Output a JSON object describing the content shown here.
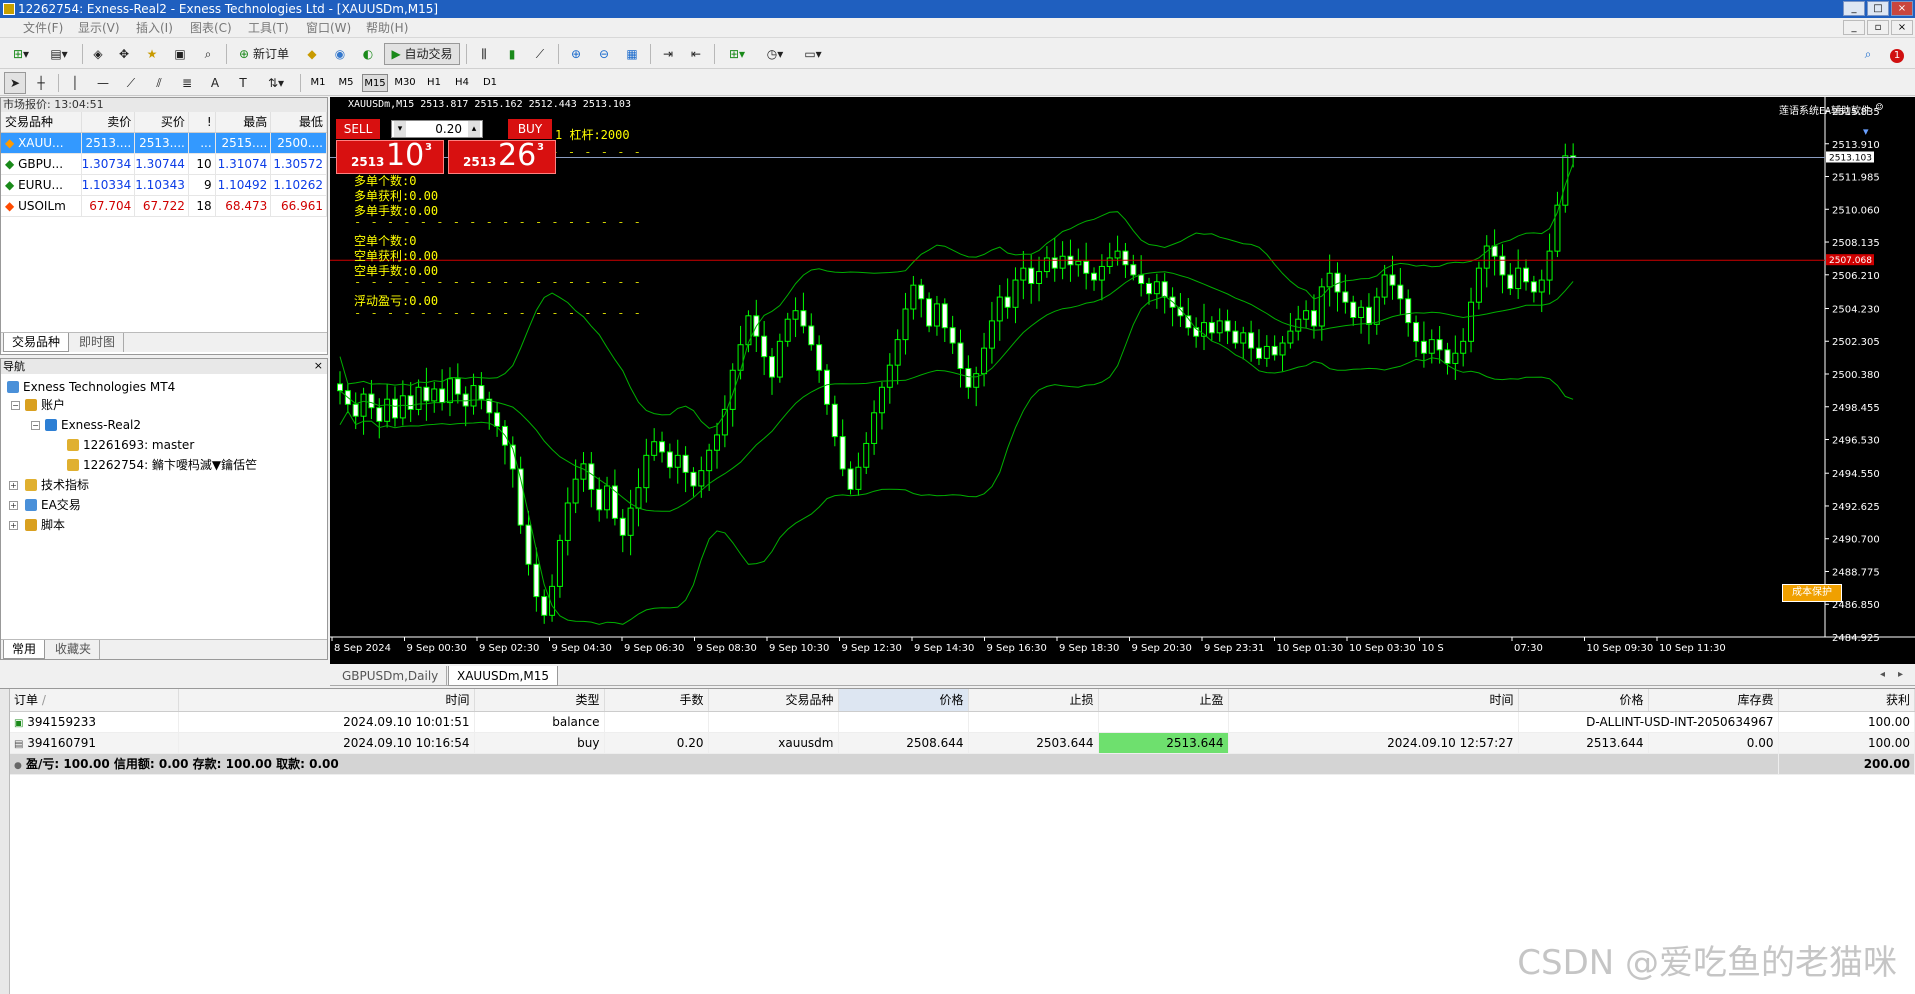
{
  "window": {
    "title": "12262754: Exness-Real2 - Exness Technologies Ltd - [XAUUSDm,M15]"
  },
  "menu": [
    "文件(F)",
    "显示(V)",
    "插入(I)",
    "图表(C)",
    "工具(T)",
    "窗口(W)",
    "帮助(H)"
  ],
  "toolbar": {
    "new_order": "新订单",
    "auto_trade": "自动交易",
    "notify_count": "1"
  },
  "timeframes": [
    "M1",
    "M5",
    "M15",
    "M30",
    "H1",
    "H4",
    "D1"
  ],
  "market_watch": {
    "title": "市场报价: 13:04:51",
    "columns": [
      "交易品种",
      "卖价",
      "买价",
      "!",
      "最高",
      "最低"
    ],
    "rows": [
      {
        "symbol": "XAUU...",
        "bid": "2513....",
        "ask": "2513....",
        "spread": "...",
        "high": "2515....",
        "low": "2500...."
      },
      {
        "symbol": "GBPU...",
        "bid": "1.30734",
        "ask": "1.30744",
        "spread": "10",
        "high": "1.31074",
        "low": "1.30572"
      },
      {
        "symbol": "EURU...",
        "bid": "1.10334",
        "ask": "1.10343",
        "spread": "9",
        "high": "1.10492",
        "low": "1.10262"
      },
      {
        "symbol": "USOILm",
        "bid": "67.704",
        "ask": "67.722",
        "spread": "18",
        "high": "68.473",
        "low": "66.961"
      }
    ],
    "tabs": [
      "交易品种",
      "即时图"
    ]
  },
  "navigator": {
    "title": "导航",
    "root": "Exness Technologies MT4",
    "accounts": "账户",
    "server": "Exness-Real2",
    "acc1": "12261693: master",
    "acc2": "12262754: 鏅卞噯杩滅▼鑰佸笀",
    "indicators": "技术指标",
    "ea": "EA交易",
    "scripts": "脚本",
    "tabs": [
      "常用",
      "收藏夹"
    ]
  },
  "chart": {
    "header": "XAUUSDm,M15  2513.817 2515.162 2512.443 2513.103",
    "ea_name": "莲语系统EA辅助软件",
    "leverage": "1 杠杆:2000",
    "long_count": "多单个数:0",
    "long_profit": "多单获利:0.00",
    "long_lots": "多单手数:0.00",
    "short_count": "空单个数:0",
    "short_profit": "空单获利:0.00",
    "short_lots": "空单手数:0.00",
    "floating": "浮动盈亏:0.00",
    "sell_label": "SELL",
    "buy_label": "BUY",
    "lots": "0.20",
    "sell_price_small": "2513",
    "sell_price_big": "10",
    "sell_price_sup": "3",
    "buy_price_small": "2513",
    "buy_price_big": "26",
    "buy_price_sup": "3",
    "protect_btn": "成本保护",
    "current_price": "2513.103",
    "line_price": "2507.068",
    "price_labels": [
      "2515.835",
      "2513.910",
      "2511.985",
      "2510.060",
      "2508.135",
      "2506.210",
      "2504.230",
      "2502.305",
      "2500.380",
      "2498.455",
      "2496.530",
      "2494.550",
      "2492.625",
      "2490.700",
      "2488.775",
      "2486.850",
      "2484.925"
    ],
    "time_labels": [
      "8 Sep 2024",
      "9 Sep 00:30",
      "9 Sep 02:30",
      "9 Sep 04:30",
      "9 Sep 06:30",
      "9 Sep 08:30",
      "9 Sep 10:30",
      "9 Sep 12:30",
      "9 Sep 14:30",
      "9 Sep 16:30",
      "9 Sep 18:30",
      "9 Sep 20:30",
      "9 Sep 23:31",
      "10 Sep 01:30",
      "10 Sep 03:30",
      "10 S",
      "07:30",
      "10 Sep 09:30",
      "10 Sep 11:30"
    ],
    "tabs": [
      "GBPUSDm,Daily",
      "XAUUSDm,M15"
    ]
  },
  "chart_data": {
    "type": "candlestick",
    "symbol": "XAUUSDm",
    "timeframe": "M15",
    "ylim": [
      2484.925,
      2515.835
    ],
    "closes": [
      2499.4,
      2498.6,
      2497.9,
      2499.2,
      2498.4,
      2497.6,
      2498.9,
      2497.8,
      2499.1,
      2498.3,
      2499.6,
      2498.8,
      2499.5,
      2498.7,
      2500.1,
      2499.2,
      2498.5,
      2499.7,
      2498.9,
      2498.1,
      2497.3,
      2496.2,
      2494.8,
      2491.5,
      2489.2,
      2487.3,
      2486.2,
      2487.9,
      2490.6,
      2492.8,
      2494.2,
      2495.1,
      2493.6,
      2492.4,
      2493.8,
      2491.9,
      2490.9,
      2492.5,
      2493.7,
      2495.6,
      2496.4,
      2495.8,
      2494.9,
      2495.6,
      2494.6,
      2493.8,
      2494.7,
      2495.9,
      2496.8,
      2498.3,
      2500.6,
      2502.1,
      2503.8,
      2502.6,
      2501.4,
      2500.2,
      2502.3,
      2503.6,
      2504.1,
      2503.2,
      2502.1,
      2500.6,
      2498.6,
      2496.7,
      2494.8,
      2493.6,
      2494.9,
      2496.3,
      2498.1,
      2499.6,
      2500.9,
      2502.4,
      2504.2,
      2505.6,
      2504.8,
      2503.2,
      2504.5,
      2503.1,
      2502.2,
      2500.7,
      2499.6,
      2500.4,
      2501.9,
      2503.5,
      2504.9,
      2504.3,
      2505.9,
      2506.6,
      2505.7,
      2506.4,
      2507.2,
      2506.6,
      2507.3,
      2506.8,
      2507.0,
      2506.3,
      2505.9,
      2506.7,
      2507.2,
      2507.6,
      2506.8,
      2506.2,
      2505.7,
      2505.1,
      2505.8,
      2504.9,
      2504.3,
      2503.8,
      2503.1,
      2502.6,
      2503.4,
      2502.8,
      2503.5,
      2502.9,
      2502.2,
      2502.8,
      2501.9,
      2501.3,
      2502.0,
      2501.5,
      2502.2,
      2502.9,
      2503.6,
      2504.1,
      2503.2,
      2505.5,
      2506.3,
      2505.2,
      2504.6,
      2503.7,
      2504.3,
      2503.3,
      2504.9,
      2506.2,
      2505.6,
      2504.8,
      2503.4,
      2502.3,
      2501.6,
      2502.4,
      2501.8,
      2501.0,
      2501.6,
      2502.3,
      2504.6,
      2506.6,
      2507.9,
      2507.3,
      2506.2,
      2505.4,
      2506.6,
      2505.8,
      2505.2,
      2505.9,
      2507.6,
      2510.3,
      2513.2,
      2513.1
    ]
  },
  "terminal": {
    "columns": [
      "订单",
      "时间",
      "类型",
      "手数",
      "交易品种",
      "价格",
      "止损",
      "止盈",
      "时间",
      "价格",
      "库存费",
      "获利"
    ],
    "rows": [
      {
        "order": "394159233",
        "time": "2024.09.10 10:01:51",
        "type": "balance",
        "lots": "",
        "symbol": "",
        "price": "",
        "sl": "",
        "tp": "",
        "ctime": "",
        "cprice": "D-ALLINT-USD-INT-2050634967",
        "swap": "",
        "profit": "100.00"
      },
      {
        "order": "394160791",
        "time": "2024.09.10 10:16:54",
        "type": "buy",
        "lots": "0.20",
        "symbol": "xauusdm",
        "price": "2508.644",
        "sl": "2503.644",
        "tp": "2513.644",
        "ctime": "2024.09.10 12:57:27",
        "cprice": "2513.644",
        "swap": "0.00",
        "profit": "100.00"
      }
    ],
    "summary": "盈/亏: 100.00  信用额: 0.00  存款: 100.00  取款: 0.00",
    "summary_total": "200.00"
  },
  "watermark": "CSDN @爱吃鱼的老猫咪",
  "colors": {
    "chart_bg": "#000000",
    "candle": "#00ff00",
    "band": "#00a000",
    "title_bar": "#1f5fbf",
    "sell": "#d81010",
    "selected_row": "#3399ff"
  }
}
